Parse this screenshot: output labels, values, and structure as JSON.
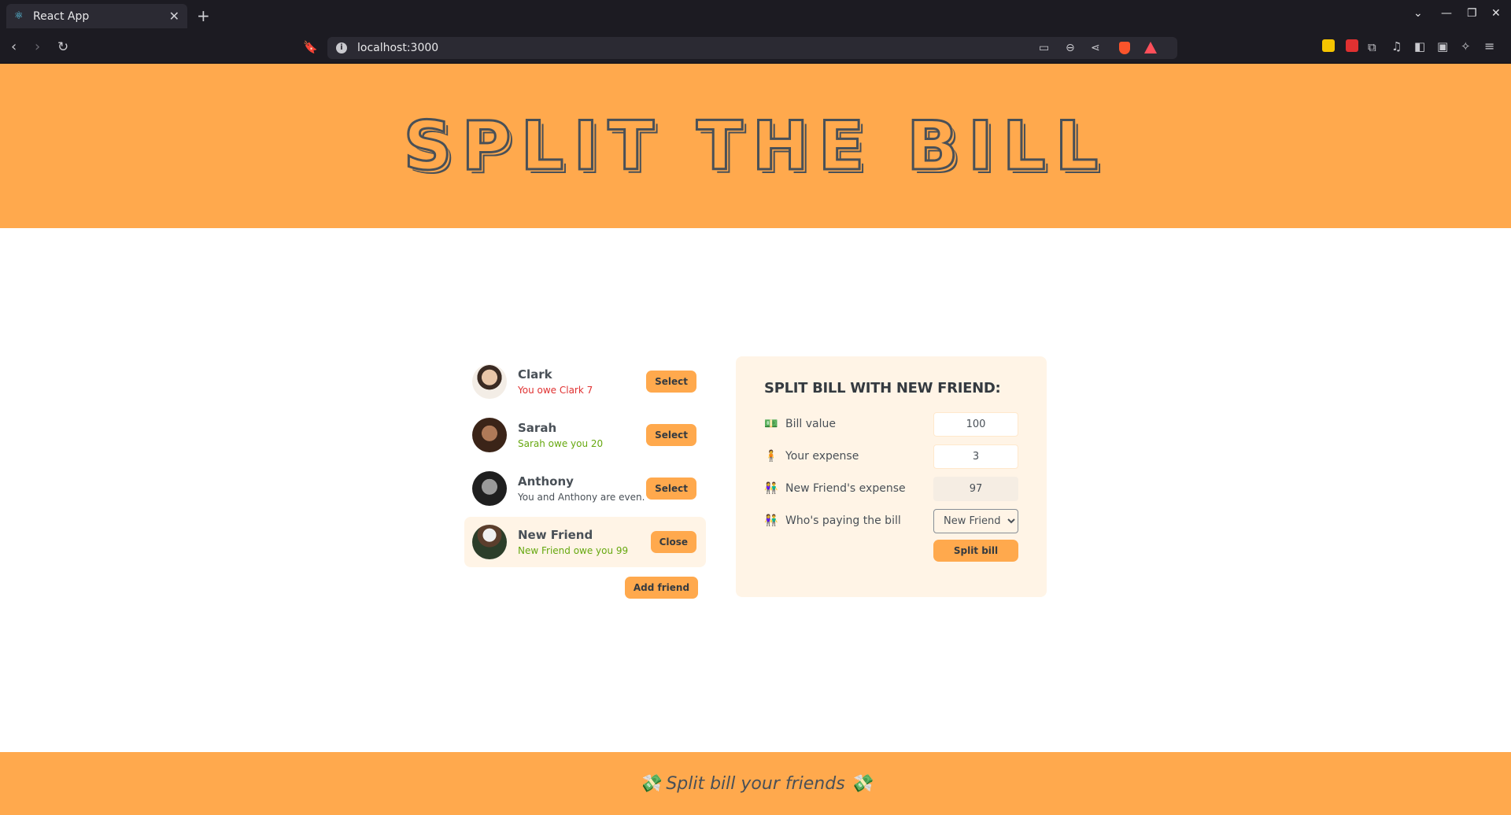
{
  "browser": {
    "tab_title": "React App",
    "tab_icon": "react-atom-icon",
    "new_tab_label": "+",
    "url": "localhost:3000",
    "window_controls": [
      "minimize",
      "maximize",
      "close"
    ]
  },
  "header": {
    "title": "SPLIT THE BILL"
  },
  "friends": [
    {
      "name": "Clark",
      "status": "You owe Clark 7",
      "status_type": "owe",
      "button": "Select"
    },
    {
      "name": "Sarah",
      "status": "Sarah owe you 20",
      "status_type": "owed",
      "button": "Select"
    },
    {
      "name": "Anthony",
      "status": "You and Anthony are even.",
      "status_type": "even",
      "button": "Select"
    },
    {
      "name": "New Friend",
      "status": "New Friend owe you 99",
      "status_type": "owed",
      "button": "Close"
    }
  ],
  "add_friend_label": "Add friend",
  "form": {
    "title": "SPLIT BILL WITH NEW FRIEND:",
    "bill_label": "Bill value",
    "bill_emoji": "💵",
    "bill_value": "100",
    "your_expense_label": "Your expense",
    "your_expense_emoji": "🧍",
    "your_expense_value": "3",
    "friend_expense_label": "New Friend's expense",
    "friend_expense_emoji": "👫",
    "friend_expense_value": "97",
    "payer_label": "Who's paying the bill",
    "payer_emoji": "🤑",
    "payer_selected": "New Friend",
    "submit_label": "Split bill"
  },
  "footer": {
    "text": "💸 Split bill your friends 💸"
  },
  "colors": {
    "accent": "#ffa94d",
    "panel": "#fff4e6",
    "text": "#495057",
    "owe": "#e03131",
    "owed": "#66a80f"
  }
}
